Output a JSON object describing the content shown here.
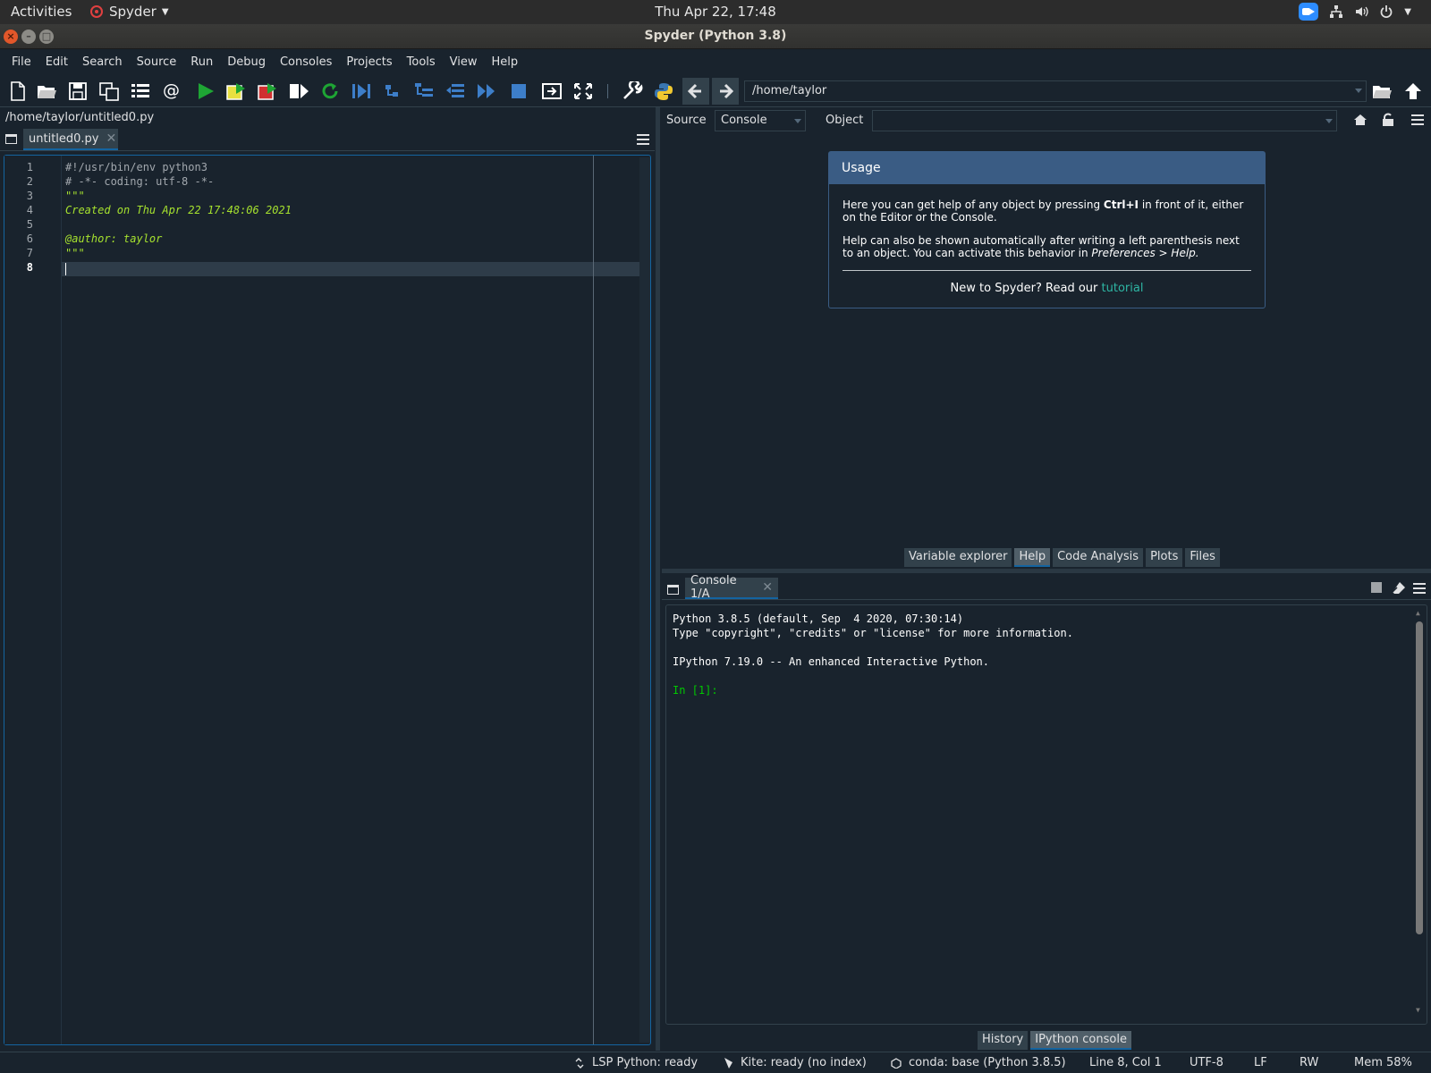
{
  "gnome": {
    "activities": "Activities",
    "app_name": "Spyder",
    "clock": "Thu Apr 22, 17:48"
  },
  "window": {
    "title": "Spyder (Python 3.8)"
  },
  "menu": [
    "File",
    "Edit",
    "Search",
    "Source",
    "Run",
    "Debug",
    "Consoles",
    "Projects",
    "Tools",
    "View",
    "Help"
  ],
  "toolbar": {
    "working_dir": "/home/taylor"
  },
  "editor": {
    "file_path": "/home/taylor/untitled0.py",
    "tab_label": "untitled0.py",
    "line_numbers": [
      "1",
      "2",
      "3",
      "4",
      "5",
      "6",
      "7",
      "8"
    ],
    "lines": [
      "#!/usr/bin/env python3",
      "# -*- coding: utf-8 -*-",
      "\"\"\"",
      "Created on Thu Apr 22 17:48:06 2021",
      "",
      "@author: taylor",
      "\"\"\"",
      ""
    ]
  },
  "help": {
    "source_label": "Source",
    "source_value": "Console",
    "object_label": "Object",
    "object_value": "",
    "usage_title": "Usage",
    "para1_a": "Here you can get help of any object by pressing ",
    "para1_b": "Ctrl+I",
    "para1_c": " in front of it, either on the Editor or the Console.",
    "para2_a": "Help can also be shown automatically after writing a left parenthesis next to an object. You can activate this behavior in ",
    "para2_b": "Preferences > Help.",
    "footer_text": "New to Spyder? Read our ",
    "footer_link": "tutorial",
    "tabs": [
      "Variable explorer",
      "Help",
      "Code Analysis",
      "Plots",
      "Files"
    ],
    "selected_tab": "Help"
  },
  "console": {
    "tab_label": "Console 1/A",
    "lines": [
      "Python 3.8.5 (default, Sep  4 2020, 07:30:14)",
      "Type \"copyright\", \"credits\" or \"license\" for more information.",
      "",
      "IPython 7.19.0 -- An enhanced Interactive Python.",
      ""
    ],
    "prompt": "In [1]:",
    "bottom_tabs": [
      "History",
      "IPython console"
    ],
    "selected_tab": "IPython console"
  },
  "status": {
    "lsp": "LSP Python: ready",
    "kite": "Kite: ready (no index)",
    "conda": "conda: base (Python 3.8.5)",
    "position": "Line 8, Col 1",
    "encoding": "UTF-8",
    "eol": "LF",
    "mode": "RW",
    "memory": "Mem 58%"
  },
  "colors": {
    "background": "#19232d",
    "accent": "#1464a0",
    "usage_header": "#3a5c84",
    "prompt_green": "#00c800",
    "docstring_green": "#a6e22e"
  }
}
